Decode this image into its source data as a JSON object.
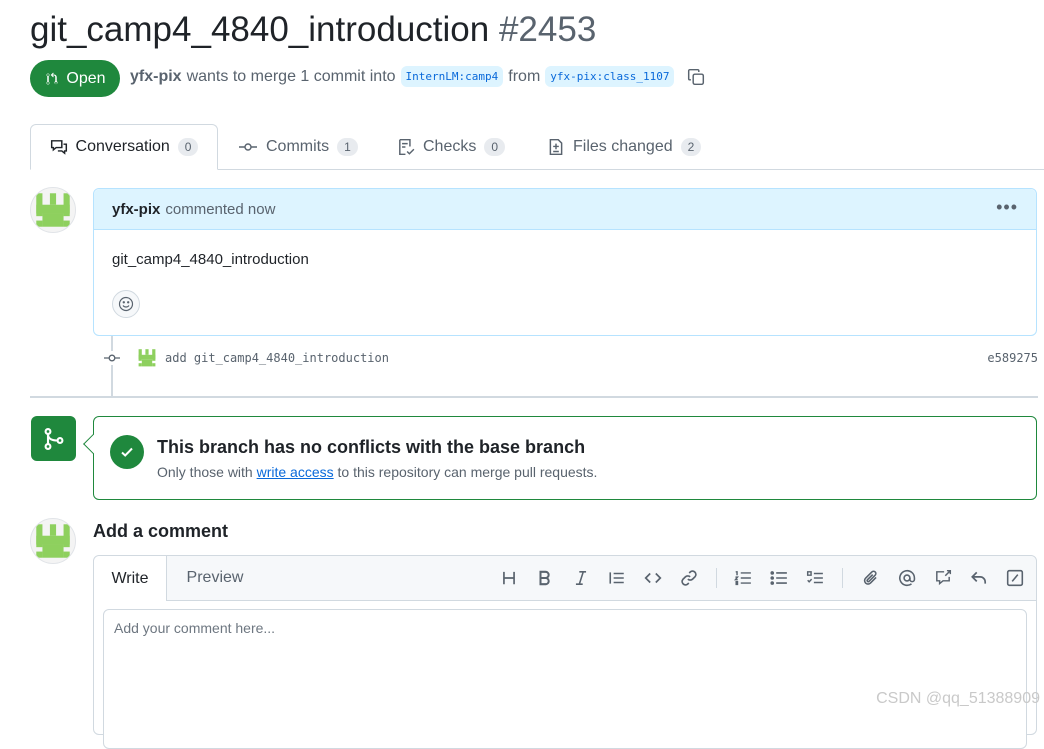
{
  "pr": {
    "title": "git_camp4_4840_introduction",
    "number": "#2453",
    "state": "Open",
    "author": "yfx-pix",
    "meta_text": "wants to merge 1 commit into",
    "base_branch": "InternLM:camp4",
    "from_text": "from",
    "head_branch": "yfx-pix:class_1107"
  },
  "tabs": [
    {
      "label": "Conversation",
      "count": "0",
      "icon": "comment-discussion-icon"
    },
    {
      "label": "Commits",
      "count": "1",
      "icon": "commit-icon"
    },
    {
      "label": "Checks",
      "count": "0",
      "icon": "checklist-icon"
    },
    {
      "label": "Files changed",
      "count": "2",
      "icon": "diff-icon"
    }
  ],
  "comment": {
    "author": "yfx-pix",
    "action": "commented now",
    "body": "git_camp4_4840_introduction"
  },
  "commit": {
    "message": "add git_camp4_4840_introduction",
    "sha": "e589275"
  },
  "merge": {
    "title": "This branch has no conflicts with the base branch",
    "sub_before": "Only those with",
    "link": "write access",
    "sub_after": "to this repository can merge pull requests."
  },
  "add_comment": {
    "title": "Add a comment",
    "write_tab": "Write",
    "preview_tab": "Preview",
    "placeholder": "Add your comment here..."
  },
  "colors": {
    "open_green": "#1f883d",
    "link_blue": "#0969da",
    "comment_header": "#ddf4ff",
    "avatar_green": "#8ed05e"
  },
  "watermark": "CSDN @qq_51388909"
}
